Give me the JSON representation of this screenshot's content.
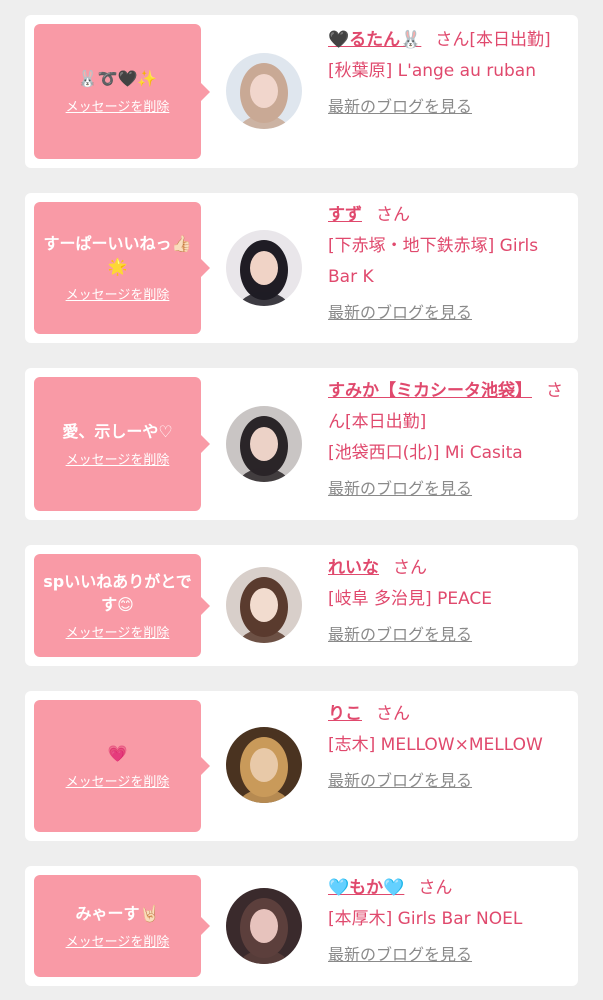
{
  "messages": [
    {
      "message": "🐰➰🖤✨",
      "delete_label": "メッセージを削除",
      "name": "🖤るたん🐰",
      "suffix": "さん[本日出勤]",
      "shop": "[秋葉原] L'ange au ruban",
      "blog_label": "最新のブログを見る",
      "avatar_colors": [
        "#dfe6ee",
        "#c9a995",
        "#f1d6cc"
      ]
    },
    {
      "message": "すーぱーいいねっ👍🏻🌟",
      "delete_label": "メッセージを削除",
      "name": "すず",
      "suffix": "さん",
      "shop": "[下赤塚・地下鉄赤塚] Girls Bar K",
      "blog_label": "最新のブログを見る",
      "avatar_colors": [
        "#e9e6ea",
        "#1f1c24",
        "#f0d3c6"
      ]
    },
    {
      "message": "愛、示しーや♡",
      "delete_label": "メッセージを削除",
      "name": "すみか【ミカシータ池袋】",
      "suffix": "さん[本日出勤]",
      "shop": "[池袋西口(北)] Mi Casita",
      "blog_label": "最新のブログを見る",
      "avatar_colors": [
        "#c9c5c4",
        "#2a2528",
        "#ecd2c7"
      ]
    },
    {
      "message": "spいいねありがとです😊",
      "delete_label": "メッセージを削除",
      "name": "れいな",
      "suffix": "さん",
      "shop": "[岐阜 多治見] PEACE",
      "blog_label": "最新のブログを見る",
      "avatar_colors": [
        "#d8cfca",
        "#5a3b2e",
        "#f2dccf"
      ]
    },
    {
      "message": "💗",
      "delete_label": "メッセージを削除",
      "name": "りこ",
      "suffix": "さん",
      "shop": "[志木] MELLOW×MELLOW",
      "blog_label": "最新のブログを見る",
      "avatar_colors": [
        "#4a3320",
        "#c99a5a",
        "#e8c9a8"
      ]
    },
    {
      "message": "みゃーす🤘🏻",
      "delete_label": "メッセージを削除",
      "name": "🩵もか🩵",
      "suffix": "さん",
      "shop": "[本厚木] Girls Bar NOEL",
      "blog_label": "最新のブログを見る",
      "avatar_colors": [
        "#3a2a2c",
        "#5c3f3c",
        "#e7c3bd"
      ]
    }
  ]
}
